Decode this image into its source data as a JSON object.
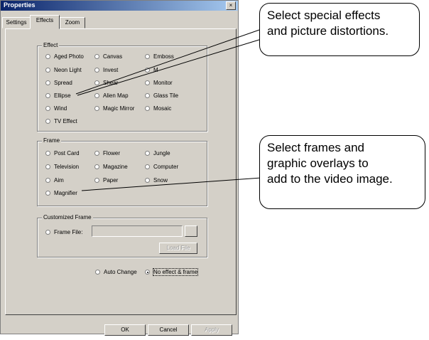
{
  "dialog": {
    "title": "Properties",
    "close_glyph": "×",
    "tabs": [
      {
        "label": "Settings",
        "active": false
      },
      {
        "label": "Effects",
        "active": true
      },
      {
        "label": "Zoom",
        "active": false
      }
    ],
    "effect_group": {
      "label": "Effect",
      "options": [
        "Aged Photo",
        "Canvas",
        "Emboss",
        "Neon Light",
        "Invest",
        "M",
        "Spread",
        "Shear",
        "Monitor",
        "Ellipse",
        "Alien Map",
        "Glass Tile",
        "Wind",
        "Magic Mirror",
        "Mosaic",
        "TV Effect"
      ]
    },
    "frame_group": {
      "label": "Frame",
      "options": [
        "Post Card",
        "Flower",
        "Jungle",
        "Television",
        "Magazine",
        "Computer",
        "Aim",
        "Paper",
        "Snow",
        "Magnifier"
      ]
    },
    "custom_frame_group": {
      "label": "Customized Frame",
      "frame_file_label": "Frame File:",
      "frame_file_value": "",
      "browse_label": "",
      "load_file_label": "Load File"
    },
    "change_options": {
      "auto_change": "Auto Change",
      "no_effect": "No effect & frame",
      "selected": "No effect & frame"
    },
    "buttons": {
      "ok": "OK",
      "cancel": "Cancel",
      "apply": "Apply"
    }
  },
  "callouts": {
    "effects": [
      "Select special effects",
      "and picture distortions."
    ],
    "frames": [
      "Select frames and",
      "graphic overlays to",
      "add to the video image."
    ]
  },
  "colors": {
    "dialog_bg": "#d4d0c8",
    "titlebar_start": "#0a246a",
    "titlebar_end": "#a6caf0"
  },
  "icons": {
    "close": "close-icon"
  }
}
